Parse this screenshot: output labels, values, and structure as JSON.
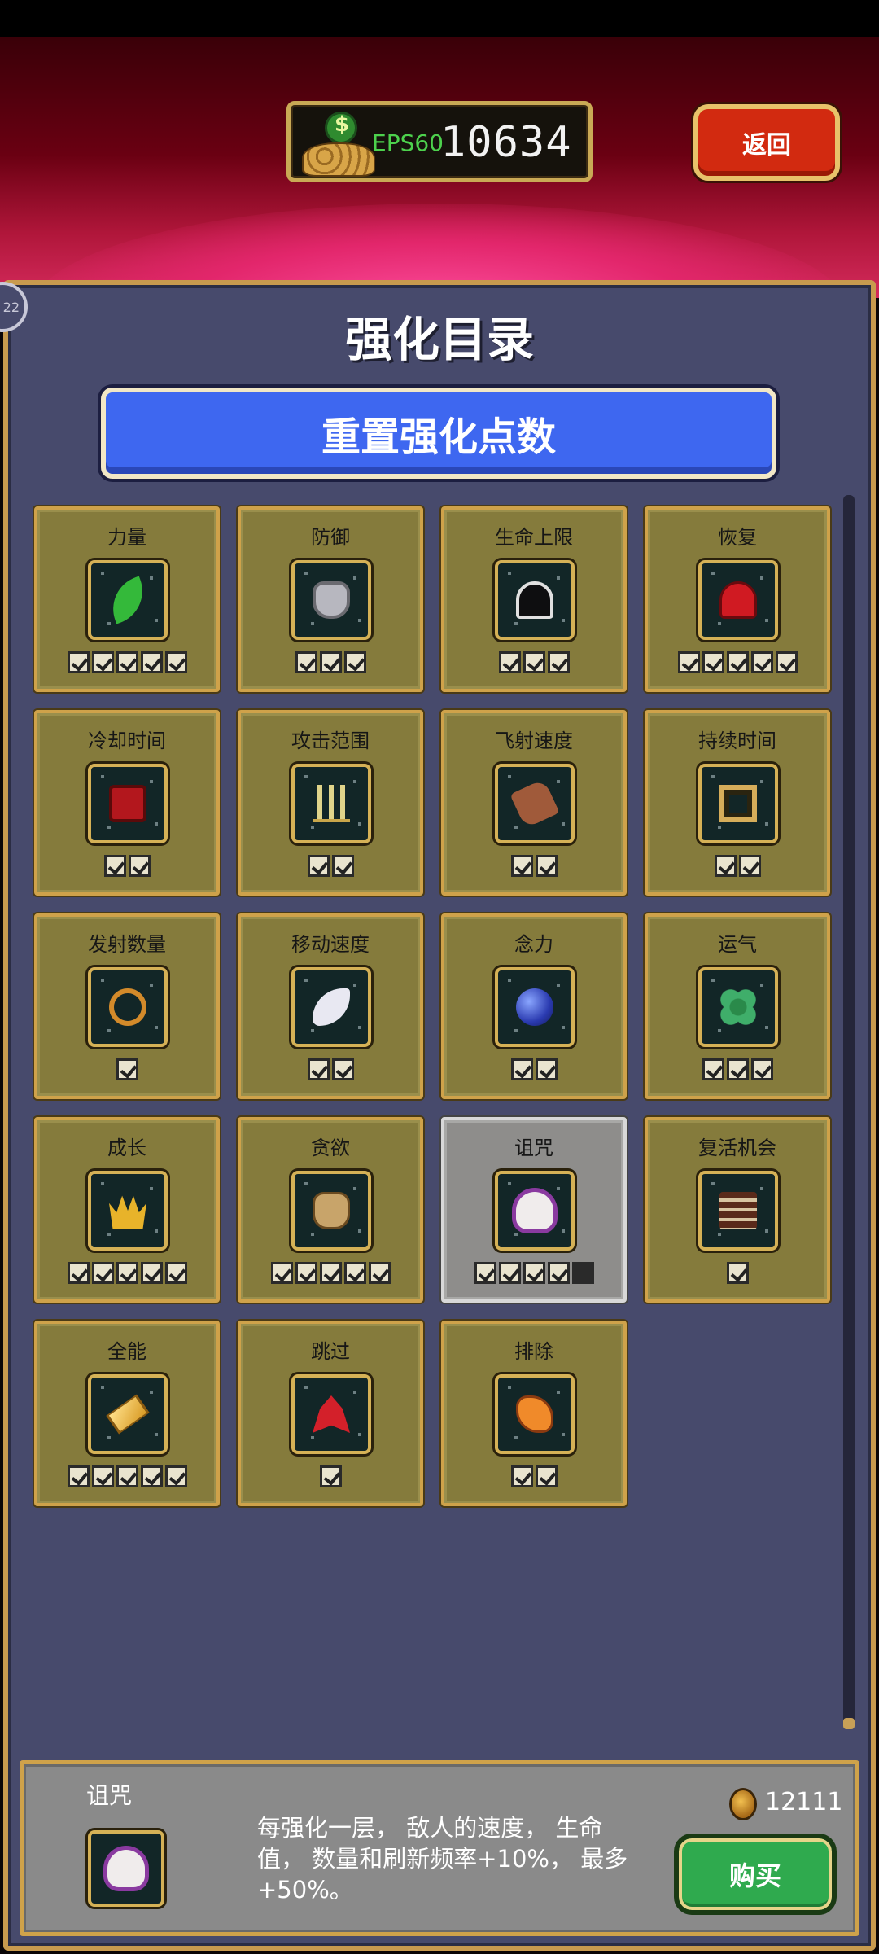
{
  "header": {
    "eps_label": "EPS60",
    "coins": "10634",
    "back_label": "返回"
  },
  "panel": {
    "title": "强化目录",
    "reset_label": "重置强化点数",
    "corner_badge": "22"
  },
  "upgrades": [
    {
      "name": "力量",
      "icon": "feather-icon",
      "levels": [
        1,
        1,
        1,
        1,
        1
      ]
    },
    {
      "name": "防御",
      "icon": "armor-icon",
      "levels": [
        1,
        1,
        1
      ]
    },
    {
      "name": "生命上限",
      "icon": "dark-heart-icon",
      "levels": [
        1,
        1,
        1
      ]
    },
    {
      "name": "恢复",
      "icon": "red-heart-icon",
      "levels": [
        1,
        1,
        1,
        1,
        1
      ]
    },
    {
      "name": "冷却时间",
      "icon": "spellbook-icon",
      "levels": [
        1,
        1
      ]
    },
    {
      "name": "攻击范围",
      "icon": "candelabra-icon",
      "levels": [
        1,
        1
      ]
    },
    {
      "name": "飞射速度",
      "icon": "gauntlet-icon",
      "levels": [
        1,
        1
      ]
    },
    {
      "name": "持续时间",
      "icon": "frame-icon",
      "levels": [
        1,
        1
      ]
    },
    {
      "name": "发射数量",
      "icon": "ring-icon",
      "levels": [
        1
      ]
    },
    {
      "name": "移动速度",
      "icon": "wing-icon",
      "levels": [
        1,
        1
      ]
    },
    {
      "name": "念力",
      "icon": "orb-icon",
      "levels": [
        1,
        1
      ]
    },
    {
      "name": "运气",
      "icon": "clover-icon",
      "levels": [
        1,
        1,
        1
      ]
    },
    {
      "name": "成长",
      "icon": "crown-icon",
      "levels": [
        1,
        1,
        1,
        1,
        1
      ]
    },
    {
      "name": "贪欲",
      "icon": "mask-icon",
      "levels": [
        1,
        1,
        1,
        1,
        1
      ]
    },
    {
      "name": "诅咒",
      "icon": "skull-icon",
      "levels": [
        1,
        1,
        1,
        1,
        0
      ],
      "selected": true
    },
    {
      "name": "复活机会",
      "icon": "cake-icon",
      "levels": [
        1
      ]
    },
    {
      "name": "全能",
      "icon": "gold-bar-icon",
      "levels": [
        1,
        1,
        1,
        1,
        1
      ]
    },
    {
      "name": "跳过",
      "icon": "rocket-icon",
      "levels": [
        1
      ]
    },
    {
      "name": "排除",
      "icon": "hand-icon",
      "levels": [
        1,
        1
      ]
    }
  ],
  "detail": {
    "name": "诅咒",
    "icon": "skull-icon",
    "description": "每强化一层， 敌人的速度， 生命值， 数量和刷新频率+10%， 最多+50%。",
    "price": "12111",
    "buy_label": "购买"
  }
}
